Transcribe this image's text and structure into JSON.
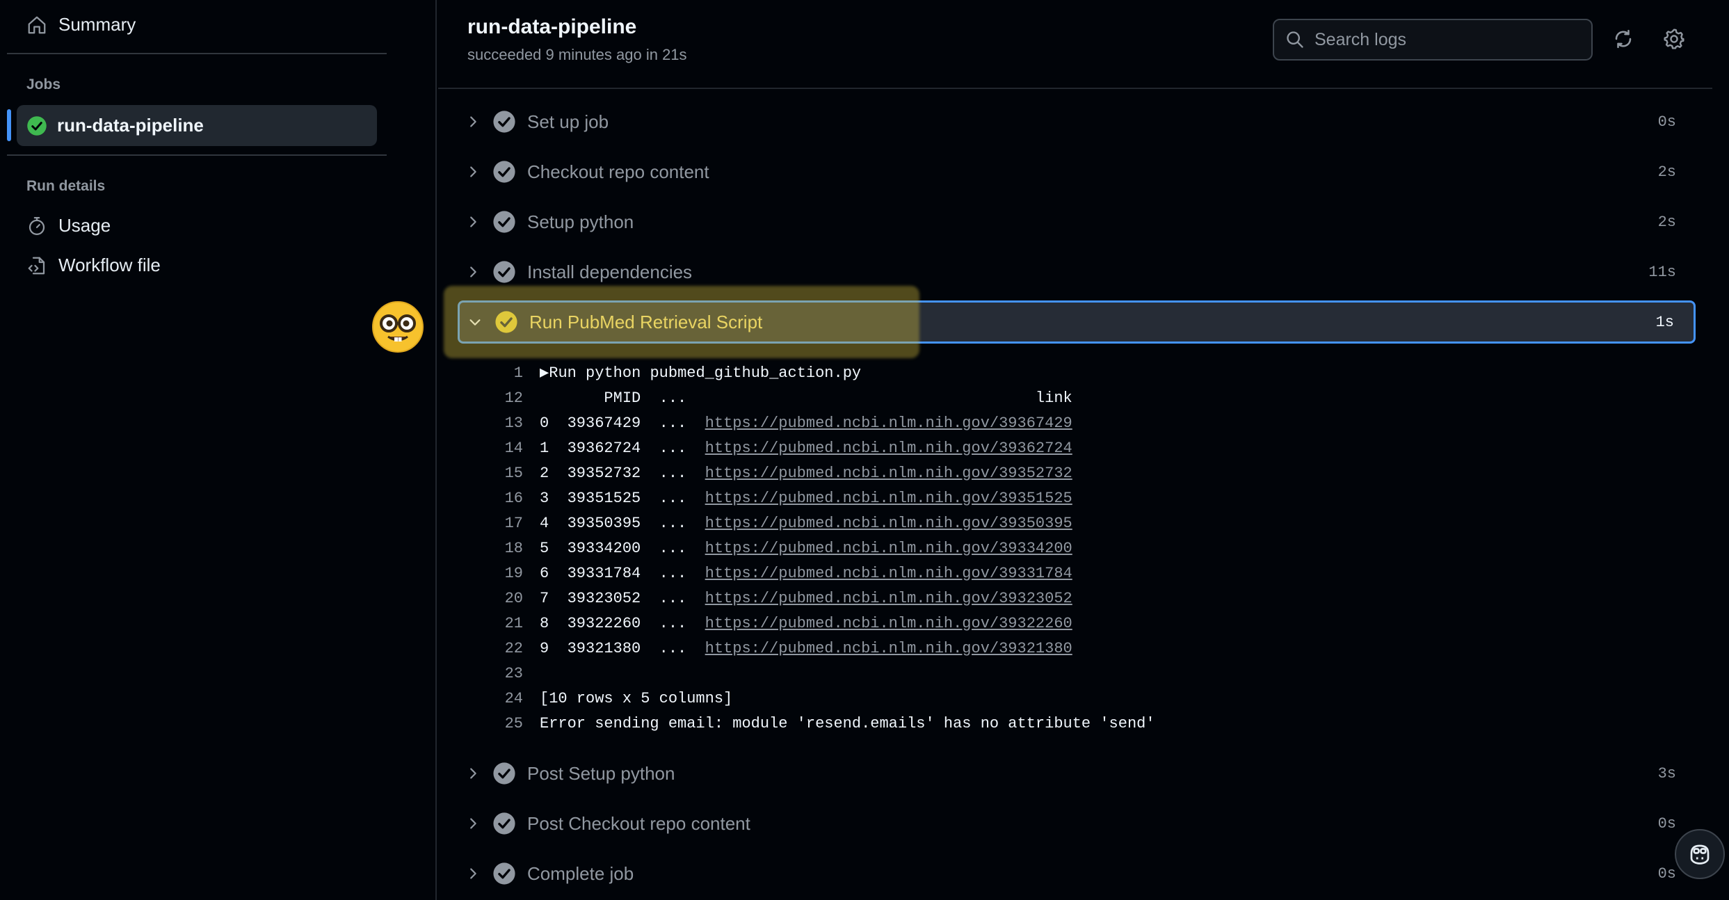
{
  "sidebar": {
    "summary_label": "Summary",
    "jobs_heading": "Jobs",
    "job_name": "run-data-pipeline",
    "run_details_heading": "Run details",
    "usage_label": "Usage",
    "workflow_file_label": "Workflow file"
  },
  "header": {
    "title": "run-data-pipeline",
    "subtitle": "succeeded 9 minutes ago in 21s",
    "search_placeholder": "Search logs"
  },
  "steps_before": [
    {
      "name": "Set up job",
      "duration": "0s"
    },
    {
      "name": "Checkout repo content",
      "duration": "2s"
    },
    {
      "name": "Setup python",
      "duration": "2s"
    },
    {
      "name": "Install dependencies",
      "duration": "11s"
    }
  ],
  "active_step": {
    "name": "Run PubMed Retrieval Script",
    "duration": "1s"
  },
  "log_lines": [
    {
      "num": "1",
      "text": "▶Run python pubmed_github_action.py",
      "link": ""
    },
    {
      "num": "12",
      "text": "       PMID  ...                                      link",
      "link": ""
    },
    {
      "num": "13",
      "text": "0  39367429  ...  ",
      "link": "https://pubmed.ncbi.nlm.nih.gov/39367429"
    },
    {
      "num": "14",
      "text": "1  39362724  ...  ",
      "link": "https://pubmed.ncbi.nlm.nih.gov/39362724"
    },
    {
      "num": "15",
      "text": "2  39352732  ...  ",
      "link": "https://pubmed.ncbi.nlm.nih.gov/39352732"
    },
    {
      "num": "16",
      "text": "3  39351525  ...  ",
      "link": "https://pubmed.ncbi.nlm.nih.gov/39351525"
    },
    {
      "num": "17",
      "text": "4  39350395  ...  ",
      "link": "https://pubmed.ncbi.nlm.nih.gov/39350395"
    },
    {
      "num": "18",
      "text": "5  39334200  ...  ",
      "link": "https://pubmed.ncbi.nlm.nih.gov/39334200"
    },
    {
      "num": "19",
      "text": "6  39331784  ...  ",
      "link": "https://pubmed.ncbi.nlm.nih.gov/39331784"
    },
    {
      "num": "20",
      "text": "7  39323052  ...  ",
      "link": "https://pubmed.ncbi.nlm.nih.gov/39323052"
    },
    {
      "num": "21",
      "text": "8  39322260  ...  ",
      "link": "https://pubmed.ncbi.nlm.nih.gov/39322260"
    },
    {
      "num": "22",
      "text": "9  39321380  ...  ",
      "link": "https://pubmed.ncbi.nlm.nih.gov/39321380"
    },
    {
      "num": "23",
      "text": "",
      "link": ""
    },
    {
      "num": "24",
      "text": "[10 rows x 5 columns]",
      "link": ""
    },
    {
      "num": "25",
      "text": "Error sending email: module 'resend.emails' has no attribute 'send'",
      "link": ""
    }
  ],
  "steps_after": [
    {
      "name": "Post Setup python",
      "duration": "3s"
    },
    {
      "name": "Post Checkout repo content",
      "duration": "0s"
    },
    {
      "name": "Complete job",
      "duration": "0s"
    }
  ],
  "colors": {
    "success": "#3fb950",
    "accent": "#4493f8",
    "highlight": "#d6be3c",
    "step_icon": "#9198a1"
  },
  "icons": [
    "home-icon",
    "check-circle-icon",
    "stopwatch-icon",
    "workflow-file-icon",
    "search-icon",
    "sync-icon",
    "gear-icon",
    "chevron-right-icon",
    "chevron-down-icon",
    "copilot-icon",
    "nerd-face-emoji"
  ]
}
